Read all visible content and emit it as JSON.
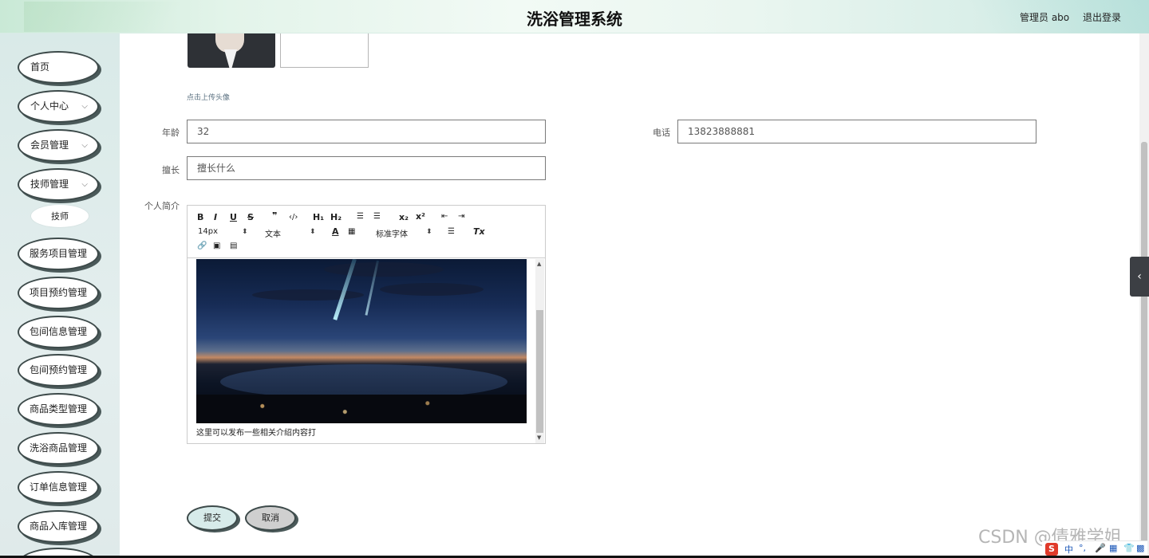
{
  "header": {
    "title": "洗浴管理系统",
    "user": "管理员 abo",
    "logout": "退出登录"
  },
  "sidebar": {
    "items": [
      {
        "label": "首页"
      },
      {
        "label": "个人中心"
      },
      {
        "label": "会员管理"
      },
      {
        "label": "技师管理"
      },
      {
        "label": "技师"
      },
      {
        "label": "服务项目管理"
      },
      {
        "label": "项目预约管理"
      },
      {
        "label": "包间信息管理"
      },
      {
        "label": "包间预约管理"
      },
      {
        "label": "商品类型管理"
      },
      {
        "label": "洗浴商品管理"
      },
      {
        "label": "订单信息管理"
      },
      {
        "label": "商品入库管理"
      }
    ]
  },
  "form": {
    "upload_tip": "点击上传头像",
    "age_label": "年龄",
    "age_value": "32",
    "phone_label": "电话",
    "phone_value": "13823888881",
    "specialty_label": "擅长",
    "specialty_value": "擅长什么",
    "intro_label": "个人简介",
    "editor": {
      "font_size": "14px",
      "block_type": "文本",
      "font_family": "标准字体",
      "content_text": "这里可以发布一些相关介绍内容打"
    },
    "submit_label": "提交",
    "cancel_label": "取消"
  },
  "overlay": {
    "watermark": "CSDN @倩雅学姐",
    "ime_zh": "中",
    "ime_dot": "°,"
  }
}
